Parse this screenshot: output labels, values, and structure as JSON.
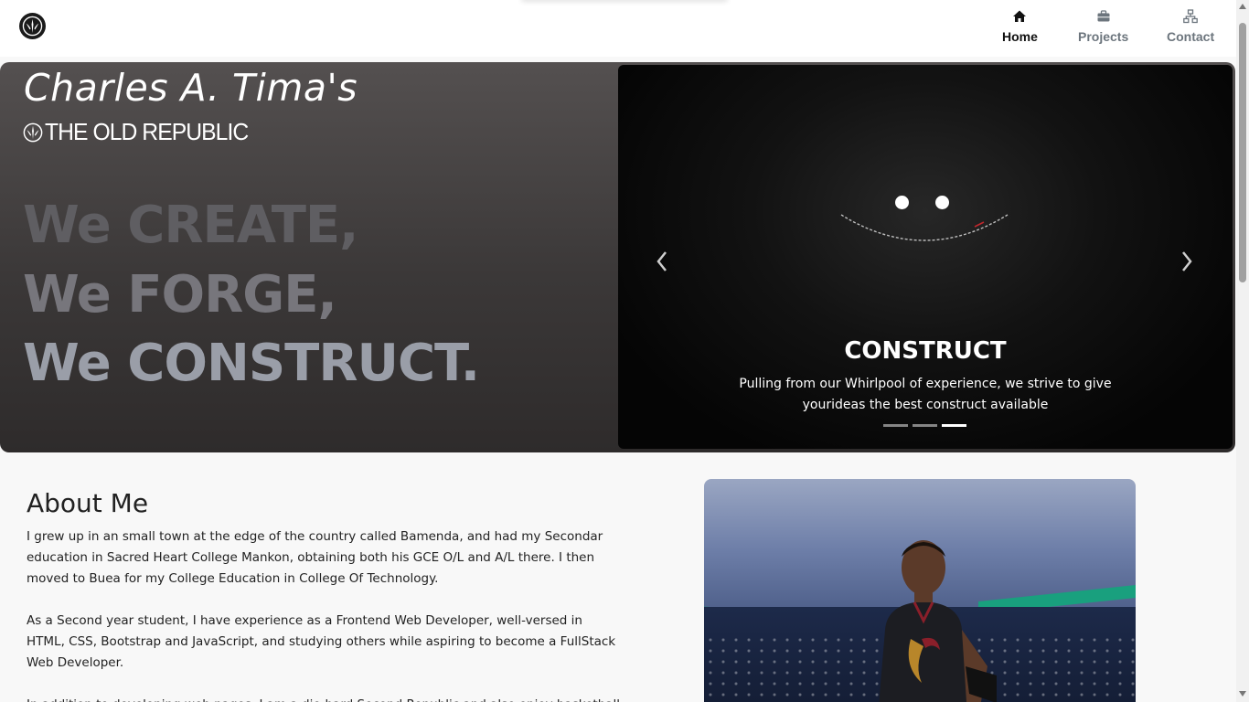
{
  "nav": {
    "logo_icon": "republic-emblem-icon",
    "items": [
      {
        "label": "Home",
        "icon": "home-icon",
        "active": true
      },
      {
        "label": "Projects",
        "icon": "briefcase-icon",
        "active": false
      },
      {
        "label": "Contact",
        "icon": "sitemap-icon",
        "active": false
      }
    ]
  },
  "hero": {
    "title": "Charles A. Tima's",
    "brand": "THE OLD REPUBLIC",
    "slogan": [
      "We CREATE,",
      "We FORGE,",
      "We CONSTRUCT."
    ]
  },
  "carousel": {
    "slide_title": "CONSTRUCT",
    "slide_text": "Pulling from our Whirlpool of experience, we strive to give yourideas the best construct available",
    "slide_count": 3,
    "active_index": 2,
    "prev_icon": "chevron-left-icon",
    "next_icon": "chevron-right-icon"
  },
  "about": {
    "heading": "About Me",
    "paragraphs": [
      "I grew up in an small town at the edge of the country called Bamenda, and had my Secondar education in Sacred Heart College Mankon, obtaining both his GCE O/L and A/L there. I then moved to Buea for my College Education in College Of Technology.",
      "As a Second year student, I have experience as a Frontend Web Developer, well-versed in HTML, CSS, Bootstrap and JavaScript, and studying others while aspiring to become a FullStack Web Developer.",
      "In addition to developing web pages, I am a die-hard Second Republic and also enjoy basketball and playing video games."
    ]
  },
  "colors": {
    "nav_active": "#111111",
    "nav_inactive": "#6c757d",
    "hero_bg": "#3b3838",
    "slogan_1": "#5f5e62",
    "slogan_2": "#77767c",
    "slogan_3": "#9a9ea8"
  }
}
